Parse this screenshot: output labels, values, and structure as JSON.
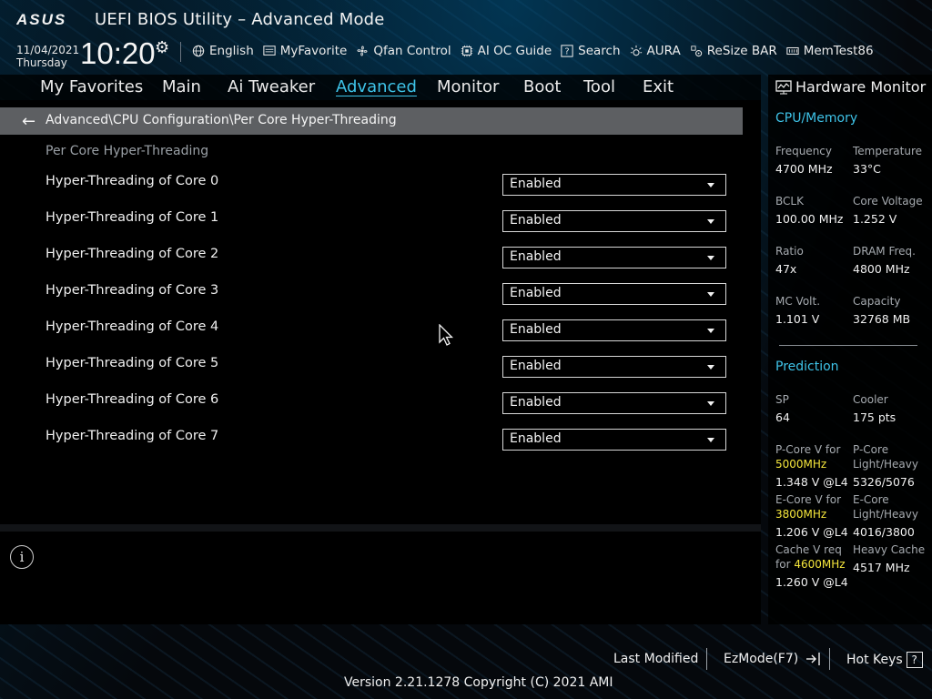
{
  "header": {
    "logo": "ASUS",
    "title": "UEFI BIOS Utility – Advanced Mode",
    "date": "11/04/2021",
    "day": "Thursday",
    "time": "10:20"
  },
  "toolbar": [
    {
      "icon": "globe-icon",
      "label": "English"
    },
    {
      "icon": "favorite-icon",
      "label": "MyFavorite"
    },
    {
      "icon": "fan-icon",
      "label": "Qfan Control"
    },
    {
      "icon": "ai-oc-icon",
      "label": "AI OC Guide"
    },
    {
      "icon": "search-icon",
      "label": "Search"
    },
    {
      "icon": "aura-icon",
      "label": "AURA"
    },
    {
      "icon": "resize-bar-icon",
      "label": "ReSize BAR"
    },
    {
      "icon": "memtest-icon",
      "label": "MemTest86"
    }
  ],
  "tabs": [
    "My Favorites",
    "Main",
    "Ai Tweaker",
    "Advanced",
    "Monitor",
    "Boot",
    "Tool",
    "Exit"
  ],
  "active_tab": "Advanced",
  "breadcrumb": "Advanced\\CPU Configuration\\Per Core Hyper-Threading",
  "section_title": "Per Core Hyper-Threading",
  "settings": [
    {
      "label": "Hyper-Threading of Core 0",
      "value": "Enabled"
    },
    {
      "label": "Hyper-Threading of Core 1",
      "value": "Enabled"
    },
    {
      "label": "Hyper-Threading of Core 2",
      "value": "Enabled"
    },
    {
      "label": "Hyper-Threading of Core 3",
      "value": "Enabled"
    },
    {
      "label": "Hyper-Threading of Core 4",
      "value": "Enabled"
    },
    {
      "label": "Hyper-Threading of Core 5",
      "value": "Enabled"
    },
    {
      "label": "Hyper-Threading of Core 6",
      "value": "Enabled"
    },
    {
      "label": "Hyper-Threading of Core 7",
      "value": "Enabled"
    }
  ],
  "hardware_monitor": {
    "title": "Hardware Monitor",
    "cpu_memory": {
      "title": "CPU/Memory",
      "frequency_label": "Frequency",
      "frequency": "4700 MHz",
      "temperature_label": "Temperature",
      "temperature": "33°C",
      "bclk_label": "BCLK",
      "bclk": "100.00 MHz",
      "core_voltage_label": "Core Voltage",
      "core_voltage": "1.252 V",
      "ratio_label": "Ratio",
      "ratio": "47x",
      "dram_label": "DRAM Freq.",
      "dram": "4800 MHz",
      "mc_volt_label": "MC Volt.",
      "mc_volt": "1.101 V",
      "capacity_label": "Capacity",
      "capacity": "32768 MB"
    },
    "prediction": {
      "title": "Prediction",
      "sp_label": "SP",
      "sp": "64",
      "cooler_label": "Cooler",
      "cooler": "175 pts",
      "pcore_v_label": "P-Core V for",
      "pcore_v_freq": "5000MHz",
      "pcore_v": "1.348 V @L4",
      "pcore_lh_label1": "P-Core",
      "pcore_lh_label2": "Light/Heavy",
      "pcore_lh": "5326/5076",
      "ecore_v_label": "E-Core V for",
      "ecore_v_freq": "3800MHz",
      "ecore_v": "1.206 V @L4",
      "ecore_lh_label1": "E-Core",
      "ecore_lh_label2": "Light/Heavy",
      "ecore_lh": "4016/3800",
      "cache_v_label1": "Cache V req",
      "cache_v_label2": "for",
      "cache_v_freq": "4600MHz",
      "cache_v": "1.260 V @L4",
      "heavy_cache_label": "Heavy Cache",
      "heavy_cache": "4517 MHz"
    }
  },
  "footer": {
    "last_modified": "Last Modified",
    "ezmode": "EzMode(F7)",
    "hotkeys": "Hot Keys",
    "hotkeys_key": "?",
    "version": "Version 2.21.1278 Copyright (C) 2021 AMI"
  },
  "colors": {
    "accent": "#3ec3e8",
    "highlight": "#f5e63c",
    "breadcrumb_bg": "#5d5f62"
  }
}
